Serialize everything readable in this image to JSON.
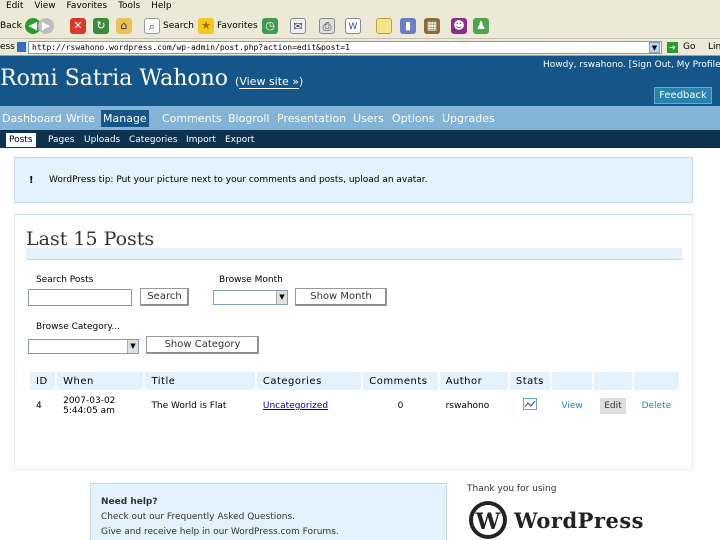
{
  "browser": {
    "menu": [
      "Edit",
      "View",
      "Favorites",
      "Tools",
      "Help"
    ],
    "toolbar": {
      "back": "Back",
      "search": "Search",
      "favorites": "Favorites"
    },
    "address_label": "ess",
    "url": "http://rswahono.wordpress.com/wp-admin/post.php?action=edit&post=1",
    "go": "Go",
    "links": "Lin"
  },
  "header": {
    "howdy": "Howdy, rswahono. [Sign Out, My Profile]",
    "blog_title": "Romi Satria Wahono",
    "view_site": "View site »",
    "feedback": "Feedback"
  },
  "nav": [
    "Dashboard",
    "Write",
    "Manage",
    "Comments",
    "Blogroll",
    "Presentation",
    "Users",
    "Options",
    "Upgrades"
  ],
  "subnav": [
    "Posts",
    "Pages",
    "Uploads",
    "Categories",
    "Import",
    "Export"
  ],
  "tip": {
    "mark": "!",
    "text": "WordPress tip: Put your picture next to your comments and posts, upload an avatar."
  },
  "page_title": "Last 15 Posts",
  "filters": {
    "search_label": "Search Posts",
    "search_button": "Search",
    "month_label": "Browse Month",
    "month_button": "Show Month",
    "category_label": "Browse Category...",
    "category_button": "Show Category"
  },
  "table": {
    "headers": [
      "ID",
      "When",
      "Title",
      "Categories",
      "Comments",
      "Author",
      "Stats",
      "",
      "",
      ""
    ],
    "rows": [
      {
        "id": "4",
        "when_date": "2007-03-02",
        "when_time": "5:44:05 am",
        "title": "The World is Flat",
        "category": "Uncategorized",
        "comments": "0",
        "author": "rswahono",
        "view": "View",
        "edit": "Edit",
        "delete": "Delete"
      }
    ]
  },
  "help": {
    "title": "Need help?",
    "line1": "Check out our Frequently Asked Questions.",
    "line2": "Give and receive help in our WordPress.com Forums."
  },
  "footer": {
    "thanks": "Thank you for using",
    "logo_text": "WordPress"
  },
  "colors": {
    "wp_dark": "#14568a",
    "wp_nav": "#83b4d8",
    "wp_subnav": "#0d324f",
    "wp_light": "#e4f2fd"
  }
}
